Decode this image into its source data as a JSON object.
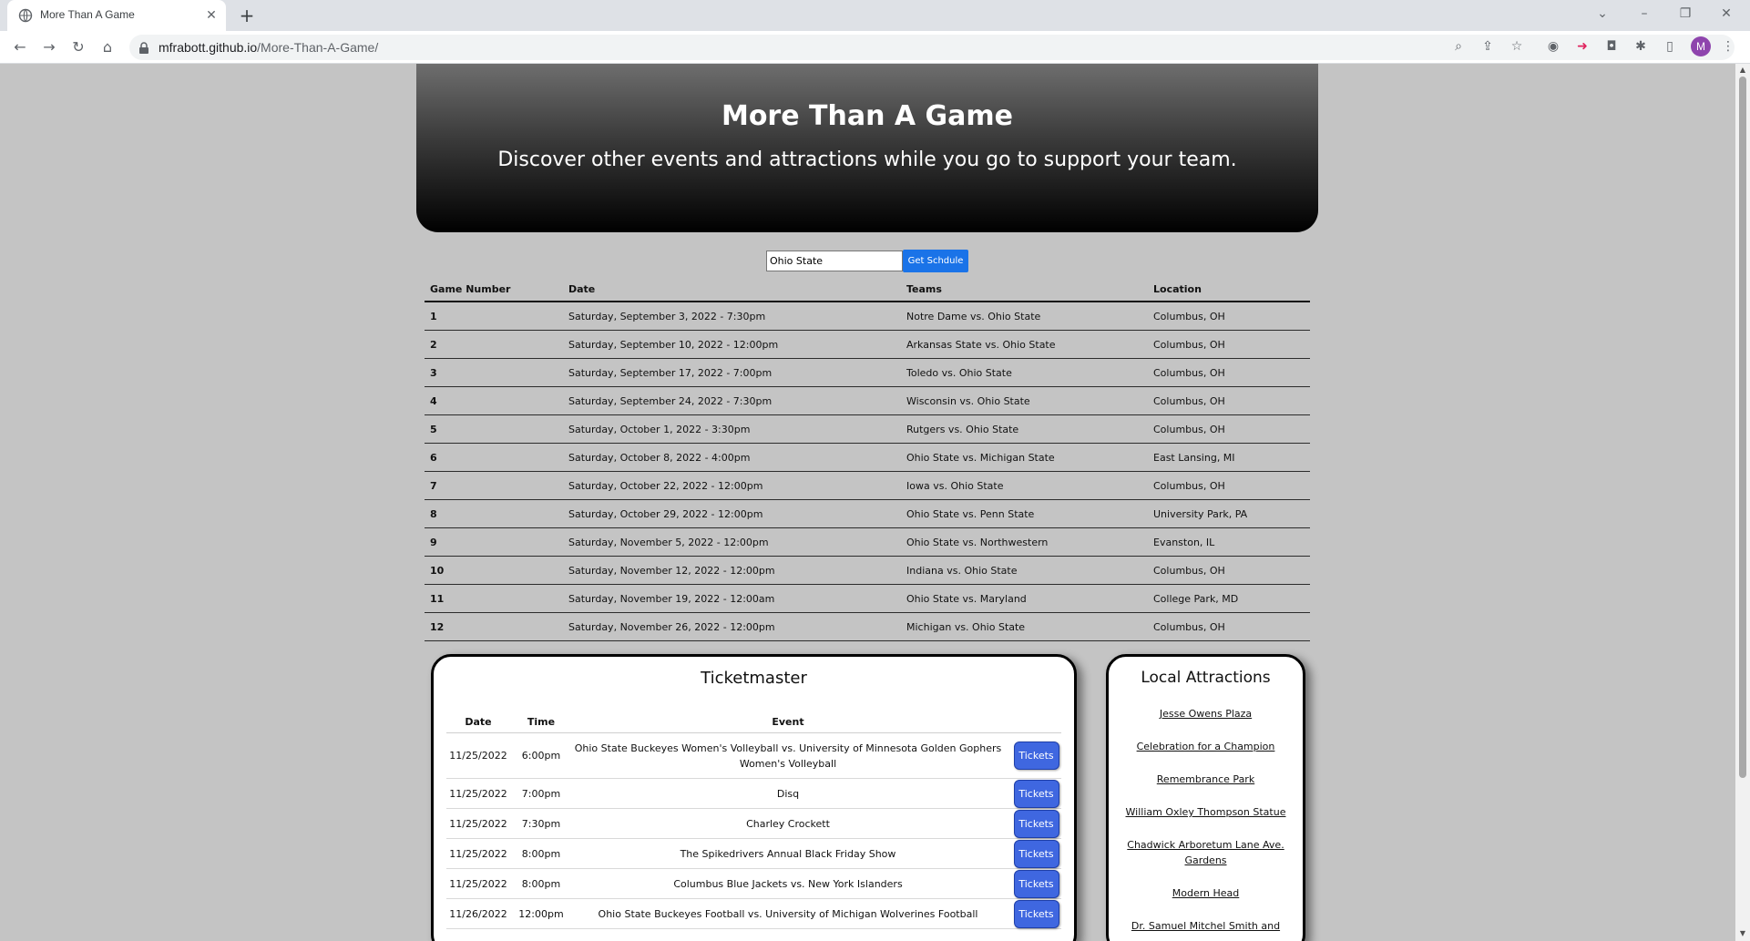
{
  "browser": {
    "tab_title": "More Than A Game",
    "new_tab": "+",
    "url_host": "mfrabott.github.io",
    "url_path": "/More-Than-A-Game/",
    "avatar_letter": "M"
  },
  "hero": {
    "title": "More Than A Game",
    "subtitle": "Discover other events and attractions while you go to support your team."
  },
  "search": {
    "value": "Ohio State",
    "button_label": "Get Schdule"
  },
  "schedule": {
    "headers": [
      "Game Number",
      "Date",
      "Teams",
      "Location"
    ],
    "rows": [
      {
        "num": "1",
        "date": "Saturday, September 3, 2022 - 7:30pm",
        "teams": "Notre Dame vs. Ohio State",
        "location": "Columbus, OH"
      },
      {
        "num": "2",
        "date": "Saturday, September 10, 2022 - 12:00pm",
        "teams": "Arkansas State vs. Ohio State",
        "location": "Columbus, OH"
      },
      {
        "num": "3",
        "date": "Saturday, September 17, 2022 - 7:00pm",
        "teams": "Toledo vs. Ohio State",
        "location": "Columbus, OH"
      },
      {
        "num": "4",
        "date": "Saturday, September 24, 2022 - 7:30pm",
        "teams": "Wisconsin vs. Ohio State",
        "location": "Columbus, OH"
      },
      {
        "num": "5",
        "date": "Saturday, October 1, 2022 - 3:30pm",
        "teams": "Rutgers vs. Ohio State",
        "location": "Columbus, OH"
      },
      {
        "num": "6",
        "date": "Saturday, October 8, 2022 - 4:00pm",
        "teams": "Ohio State vs. Michigan State",
        "location": "East Lansing, MI"
      },
      {
        "num": "7",
        "date": "Saturday, October 22, 2022 - 12:00pm",
        "teams": "Iowa vs. Ohio State",
        "location": "Columbus, OH"
      },
      {
        "num": "8",
        "date": "Saturday, October 29, 2022 - 12:00pm",
        "teams": "Ohio State vs. Penn State",
        "location": "University Park, PA"
      },
      {
        "num": "9",
        "date": "Saturday, November 5, 2022 - 12:00pm",
        "teams": "Ohio State vs. Northwestern",
        "location": "Evanston, IL"
      },
      {
        "num": "10",
        "date": "Saturday, November 12, 2022 - 12:00pm",
        "teams": "Indiana vs. Ohio State",
        "location": "Columbus, OH"
      },
      {
        "num": "11",
        "date": "Saturday, November 19, 2022 - 12:00am",
        "teams": "Ohio State vs. Maryland",
        "location": "College Park, MD"
      },
      {
        "num": "12",
        "date": "Saturday, November 26, 2022 - 12:00pm",
        "teams": "Michigan vs. Ohio State",
        "location": "Columbus, OH"
      }
    ]
  },
  "ticketmaster": {
    "title": "Ticketmaster",
    "headers": [
      "Date",
      "Time",
      "Event"
    ],
    "button_label": "Tickets",
    "events": [
      {
        "date": "11/25/2022",
        "time": "6:00pm",
        "event": "Ohio State Buckeyes Women's Volleyball vs. University of Minnesota Golden Gophers Women's Volleyball"
      },
      {
        "date": "11/25/2022",
        "time": "7:00pm",
        "event": "Disq"
      },
      {
        "date": "11/25/2022",
        "time": "7:30pm",
        "event": "Charley Crockett"
      },
      {
        "date": "11/25/2022",
        "time": "8:00pm",
        "event": "The Spikedrivers Annual Black Friday Show"
      },
      {
        "date": "11/25/2022",
        "time": "8:00pm",
        "event": "Columbus Blue Jackets vs. New York Islanders"
      },
      {
        "date": "11/26/2022",
        "time": "12:00pm",
        "event": "Ohio State Buckeyes Football vs. University of Michigan Wolverines Football"
      }
    ]
  },
  "attractions": {
    "title": "Local Attractions",
    "items": [
      "Jesse Owens Plaza",
      "Celebration for a Champion",
      "Remembrance Park",
      "William Oxley Thompson Statue",
      "Chadwick Arboretum Lane Ave. Gardens",
      "Modern Head",
      "Dr. Samuel Mitchel Smith and"
    ]
  },
  "colors": {
    "page_bg": "#c4c4c4",
    "button_blue": "#1a73e8",
    "ticket_blue": "#3f67e0"
  },
  "icons": [
    "globe-icon",
    "close-icon",
    "back-icon",
    "forward-icon",
    "reload-icon",
    "home-icon",
    "lock-icon",
    "zoom-icon",
    "share-icon",
    "star-icon",
    "extensions-icon",
    "sidepanel-icon",
    "menu-icon"
  ]
}
